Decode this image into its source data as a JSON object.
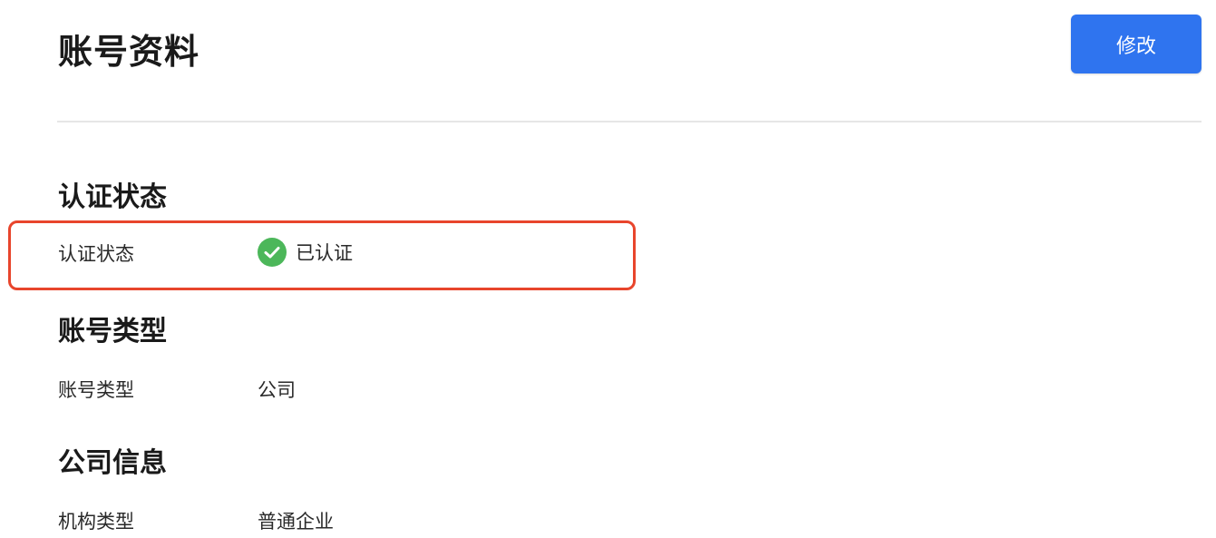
{
  "header": {
    "title": "账号资料",
    "edit_label": "修改"
  },
  "sections": {
    "verification": {
      "title": "认证状态",
      "label": "认证状态",
      "value": "已认证",
      "status_color": "#4cb75a",
      "highlight_color": "#e8452c"
    },
    "account_type": {
      "title": "账号类型",
      "label": "账号类型",
      "value": "公司"
    },
    "company_info": {
      "title": "公司信息",
      "label": "机构类型",
      "value": "普通企业"
    }
  },
  "colors": {
    "accent": "#2f74ef",
    "divider": "#e6e6e6"
  }
}
